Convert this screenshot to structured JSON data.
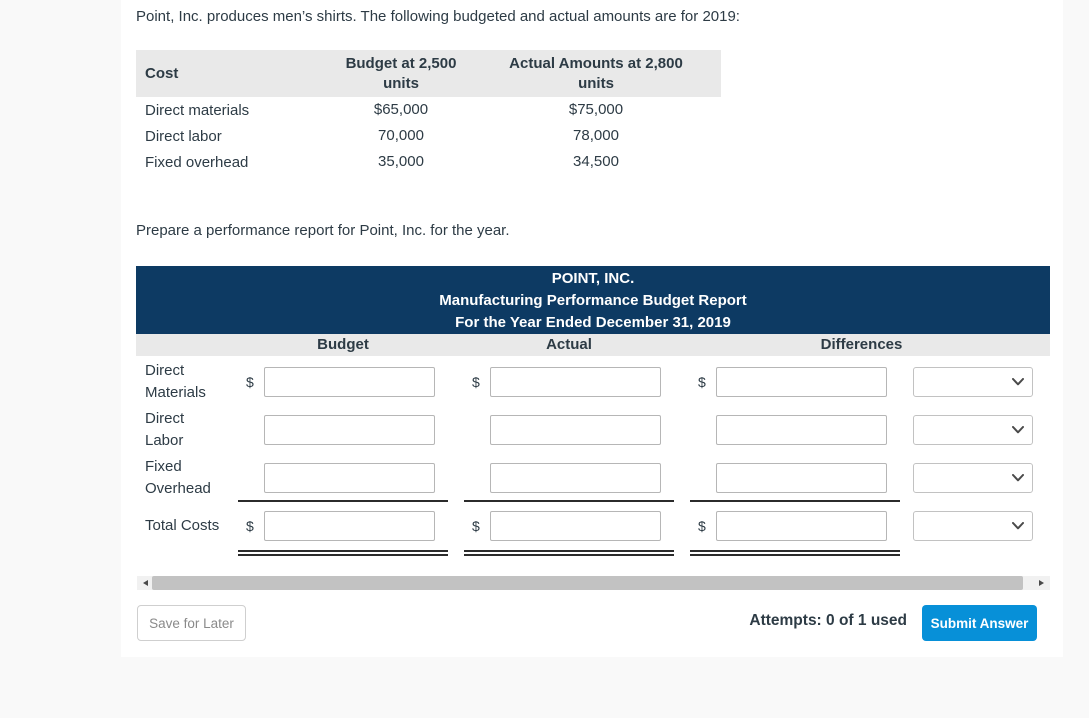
{
  "problem": {
    "intro": "Point, Inc. produces men’s shirts. The following budgeted and actual amounts are for 2019:",
    "instruction": "Prepare a performance report for Point, Inc. for the year."
  },
  "cost_table": {
    "headers": {
      "cost": "Cost",
      "budget": "Budget at 2,500 units",
      "actual": "Actual Amounts at 2,800 units"
    },
    "rows": [
      {
        "cost": "Direct materials",
        "budget": "$65,000",
        "actual": "$75,000"
      },
      {
        "cost": "Direct labor",
        "budget": "70,000",
        "actual": "78,000"
      },
      {
        "cost": "Fixed overhead",
        "budget": "35,000",
        "actual": "34,500"
      }
    ]
  },
  "report": {
    "title_line1": "POINT, INC.",
    "title_line2": "Manufacturing Performance Budget Report",
    "title_line3": "For the Year Ended December 31, 2019",
    "column_headers": {
      "budget": "Budget",
      "actual": "Actual",
      "differences": "Differences"
    },
    "rows": [
      {
        "label": "Direct Materials",
        "dollar": "$",
        "budget_value": "",
        "actual_value": "",
        "difference_value": "",
        "difference_direction": ""
      },
      {
        "label": "Direct Labor",
        "dollar": "",
        "budget_value": "",
        "actual_value": "",
        "difference_value": "",
        "difference_direction": ""
      },
      {
        "label": "Fixed Overhead",
        "dollar": "",
        "budget_value": "",
        "actual_value": "",
        "difference_value": "",
        "difference_direction": ""
      },
      {
        "label": "Total Costs",
        "dollar": "$",
        "budget_value": "",
        "actual_value": "",
        "difference_value": "",
        "difference_direction": ""
      }
    ]
  },
  "footer": {
    "save_button": "Save for Later",
    "attempts": "Attempts: 0 of 1 used",
    "submit_button": "Submit Answer"
  },
  "colors": {
    "report_header_bg": "#0d3a63",
    "table_header_bg": "#e9e9e9",
    "submit_button_bg": "#0790d8",
    "text": "#2d3b45",
    "page_bg": "#f9f9f9"
  }
}
